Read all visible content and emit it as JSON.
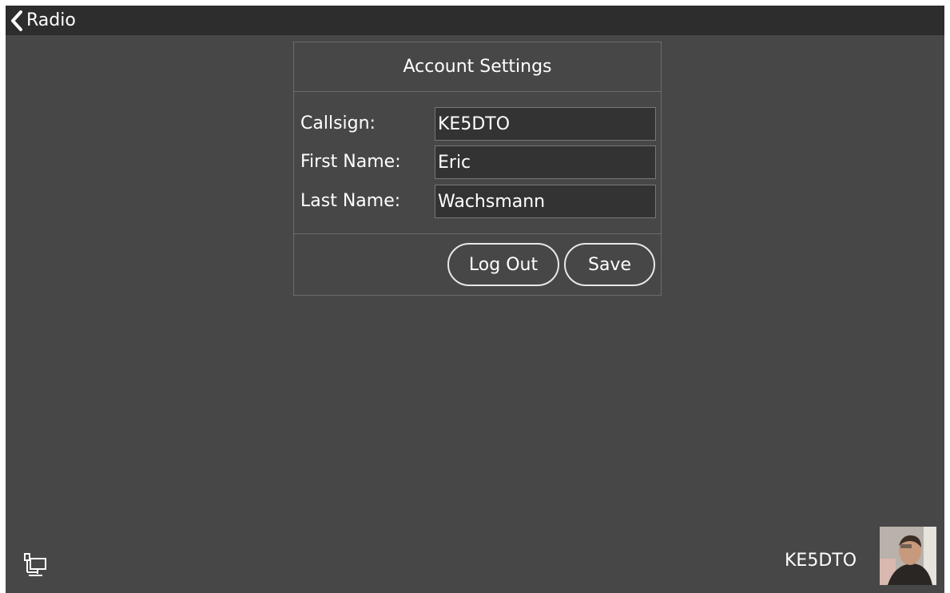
{
  "header": {
    "back_label": "Radio",
    "back_icon": "chevron-left-icon"
  },
  "account": {
    "title": "Account Settings",
    "fields": [
      {
        "label": "Callsign:",
        "value": "KE5DTO"
      },
      {
        "label": "First Name:",
        "value": "Eric"
      },
      {
        "label": "Last Name:",
        "value": "Wachsmann"
      }
    ],
    "logout_label": "Log Out",
    "save_label": "Save"
  },
  "status": {
    "network_icon": "network-computer-icon",
    "callsign": "KE5DTO",
    "avatar_icon": "user-avatar"
  },
  "colors": {
    "background": "#474747",
    "topbar": "#2d2d2d",
    "input_background": "#333333",
    "border": "#6b6b6b",
    "text": "#ffffff"
  }
}
